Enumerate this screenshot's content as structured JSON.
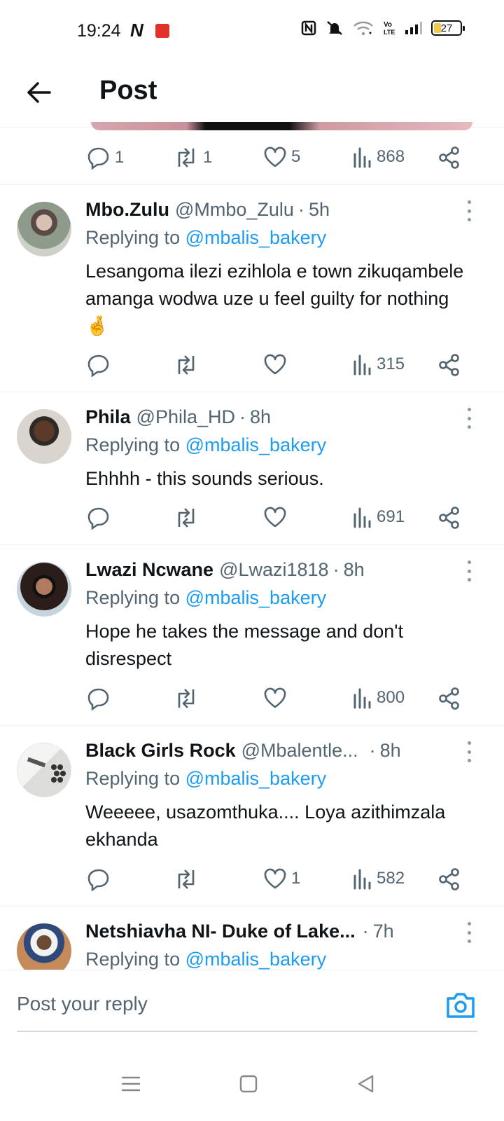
{
  "status_bar": {
    "time": "19:24",
    "n_icon": "N",
    "battery": "27",
    "volte": "Vo LTE"
  },
  "header": {
    "title": "Post",
    "back_icon": "arrow-left-icon"
  },
  "main_post_actions": {
    "replies": "1",
    "reposts": "1",
    "likes": "5",
    "views": "868"
  },
  "replies": [
    {
      "name": "Mbo.Zulu",
      "handle": "@Mmbo_Zulu",
      "dot": "·",
      "time": "5h",
      "replying_prefix": "Replying to",
      "replying_to": "@mbalis_bakery",
      "text": "Lesangoma ilezi ezihlola e town zikuqambele amanga wodwa uze u feel guilty for nothing 🤞",
      "reply_count": "",
      "repost_count": "",
      "like_count": "",
      "views": "315"
    },
    {
      "name": "Phila",
      "handle": "@Phila_HD",
      "dot": "·",
      "time": "8h",
      "replying_prefix": "Replying to",
      "replying_to": "@mbalis_bakery",
      "text": "Ehhhh - this sounds serious.",
      "reply_count": "",
      "repost_count": "",
      "like_count": "",
      "views": "691"
    },
    {
      "name": "Lwazi Ncwane",
      "handle": "@Lwazi1818",
      "dot": "·",
      "time": "8h",
      "replying_prefix": "Replying to",
      "replying_to": "@mbalis_bakery",
      "text": "Hope he takes the message and don't disrespect",
      "reply_count": "",
      "repost_count": "",
      "like_count": "",
      "views": "800"
    },
    {
      "name": "Black Girls Rock",
      "handle": "@Mbalentle...",
      "dot": "·",
      "time": "8h",
      "replying_prefix": "Replying to",
      "replying_to": "@mbalis_bakery",
      "text": "Weeeee, usazomthuka.... Loya azithimzala ekhanda",
      "reply_count": "",
      "repost_count": "",
      "like_count": "1",
      "views": "582"
    },
    {
      "name": "Netshiavha NI- Duke of Lake...",
      "handle": "",
      "dot": "·",
      "time": "7h",
      "replying_prefix": "Replying to",
      "replying_to": "@mbalis_bakery"
    }
  ],
  "reply_box": {
    "placeholder": "Post your reply",
    "camera_icon": "camera-icon"
  },
  "nav_bar": {
    "menu_icon": "menu-icon",
    "home_icon": "square-home-icon",
    "back_icon": "triangle-back-icon"
  }
}
